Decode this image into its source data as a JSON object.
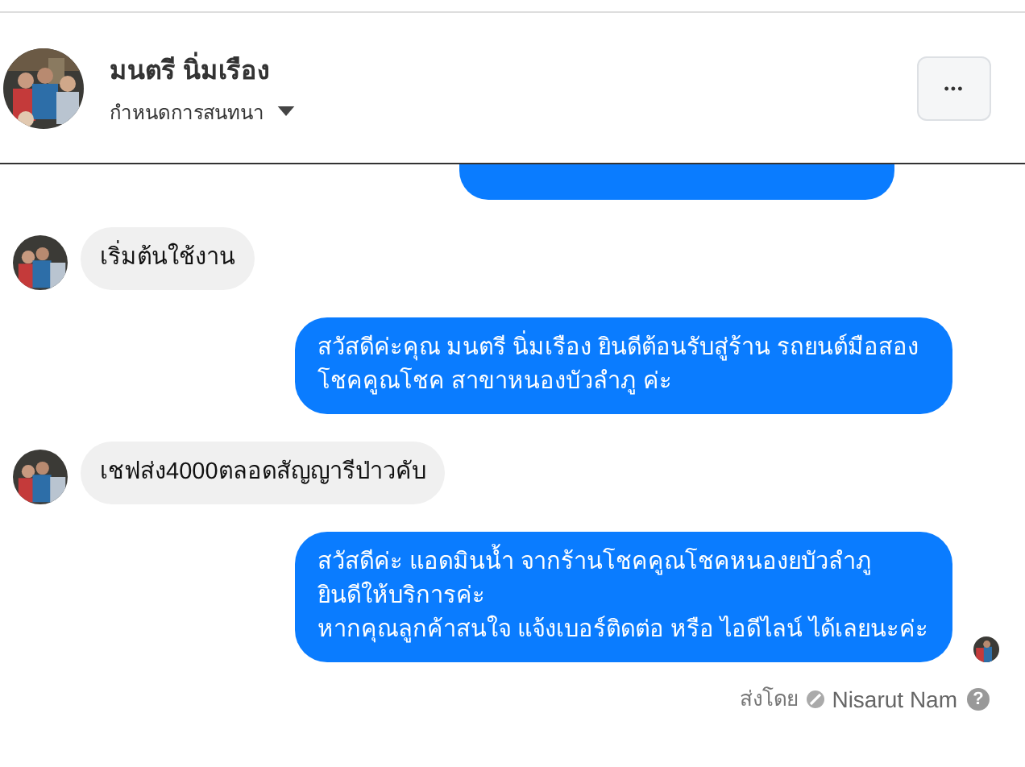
{
  "header": {
    "name": "มนตรี นิ่มเรือง",
    "subtitle": "กำหนดการสนทนา",
    "more": "•••"
  },
  "messages": [
    {
      "kind": "partial"
    },
    {
      "kind": "incoming",
      "text": "เริ่มต้นใช้งาน"
    },
    {
      "kind": "outgoing",
      "text": "สวัสดีค่ะคุณ มนตรี นิ่มเรือง ยินดีต้อนรับสู่ร้าน รถยนต์มือสอง โชคคูณโชค สาขาหนองบัวลำภู ค่ะ",
      "seen": false
    },
    {
      "kind": "incoming",
      "text": "เชฟส่ง4000ตลอดสัญญารีป่าวคับ"
    },
    {
      "kind": "outgoing",
      "text": "สวัสดีค่ะ แอดมินน้ำ จากร้านโชคคูณโชคหนองยบัวลำภู\nยินดีให้บริการค่ะ\nหากคุณลูกค้าสนใจ แจ้งเบอร์ติดต่อ หรือ ไอดีไลน์ ได้เลยนะค่ะ",
      "seen": true
    }
  ],
  "footer": {
    "label": "ส่งโดย",
    "sender": "Nisarut Nam",
    "help": "?"
  }
}
